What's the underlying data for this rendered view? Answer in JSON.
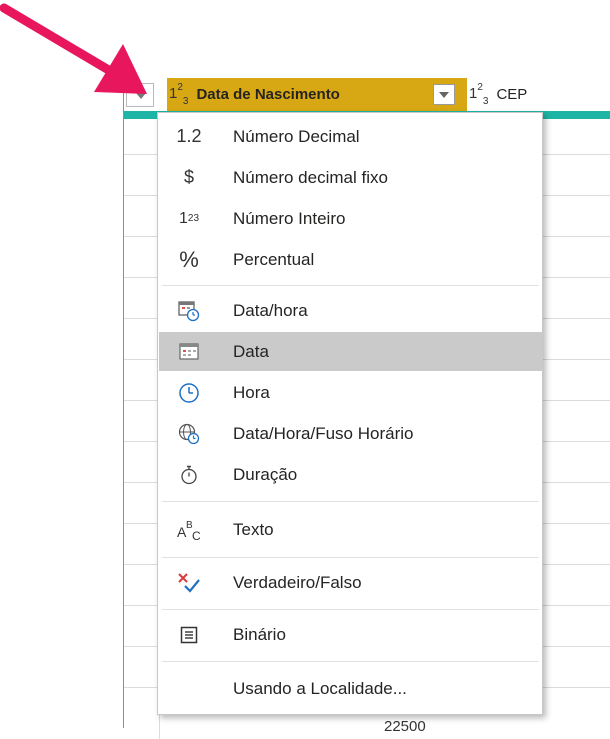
{
  "header": {
    "columns": [
      {
        "type_glyph_base": "1",
        "type_glyph_sup": "2",
        "type_glyph_sub": "3",
        "name": "Data de Nascimento"
      },
      {
        "type_glyph_base": "1",
        "type_glyph_sup": "2",
        "type_glyph_sub": "3",
        "name": "CEP"
      }
    ]
  },
  "menu": {
    "items": [
      {
        "icon": "decimal-number-icon",
        "icon_text": "1.2",
        "label": "Número Decimal"
      },
      {
        "icon": "dollar-icon",
        "icon_text": "$",
        "label": "Número decimal fixo"
      },
      {
        "icon": "whole-number-icon",
        "icon_text": "123",
        "label": "Número Inteiro"
      },
      {
        "icon": "percent-icon",
        "icon_text": "%",
        "label": "Percentual"
      },
      {
        "icon": "datetime-icon",
        "icon_text": "",
        "label": "Data/hora"
      },
      {
        "icon": "calendar-icon",
        "icon_text": "",
        "label": "Data",
        "selected": true
      },
      {
        "icon": "clock-icon",
        "icon_text": "",
        "label": "Hora"
      },
      {
        "icon": "globe-clock-icon",
        "icon_text": "",
        "label": "Data/Hora/Fuso Horário"
      },
      {
        "icon": "stopwatch-icon",
        "icon_text": "",
        "label": "Duração"
      },
      {
        "icon": "text-abc-icon",
        "icon_text": "",
        "label": "Texto"
      },
      {
        "icon": "true-false-icon",
        "icon_text": "",
        "label": "Verdadeiro/Falso"
      },
      {
        "icon": "binary-icon",
        "icon_text": "",
        "label": "Binário"
      },
      {
        "icon": "",
        "icon_text": "",
        "label": "Usando a Localidade..."
      }
    ]
  },
  "table": {
    "partial_cell_value": "22500"
  },
  "colors": {
    "selected_column_header": "#d7a813",
    "teal_accent": "#1fb5a6",
    "arrow": "#e8175d",
    "menu_selected": "#cacaca"
  }
}
